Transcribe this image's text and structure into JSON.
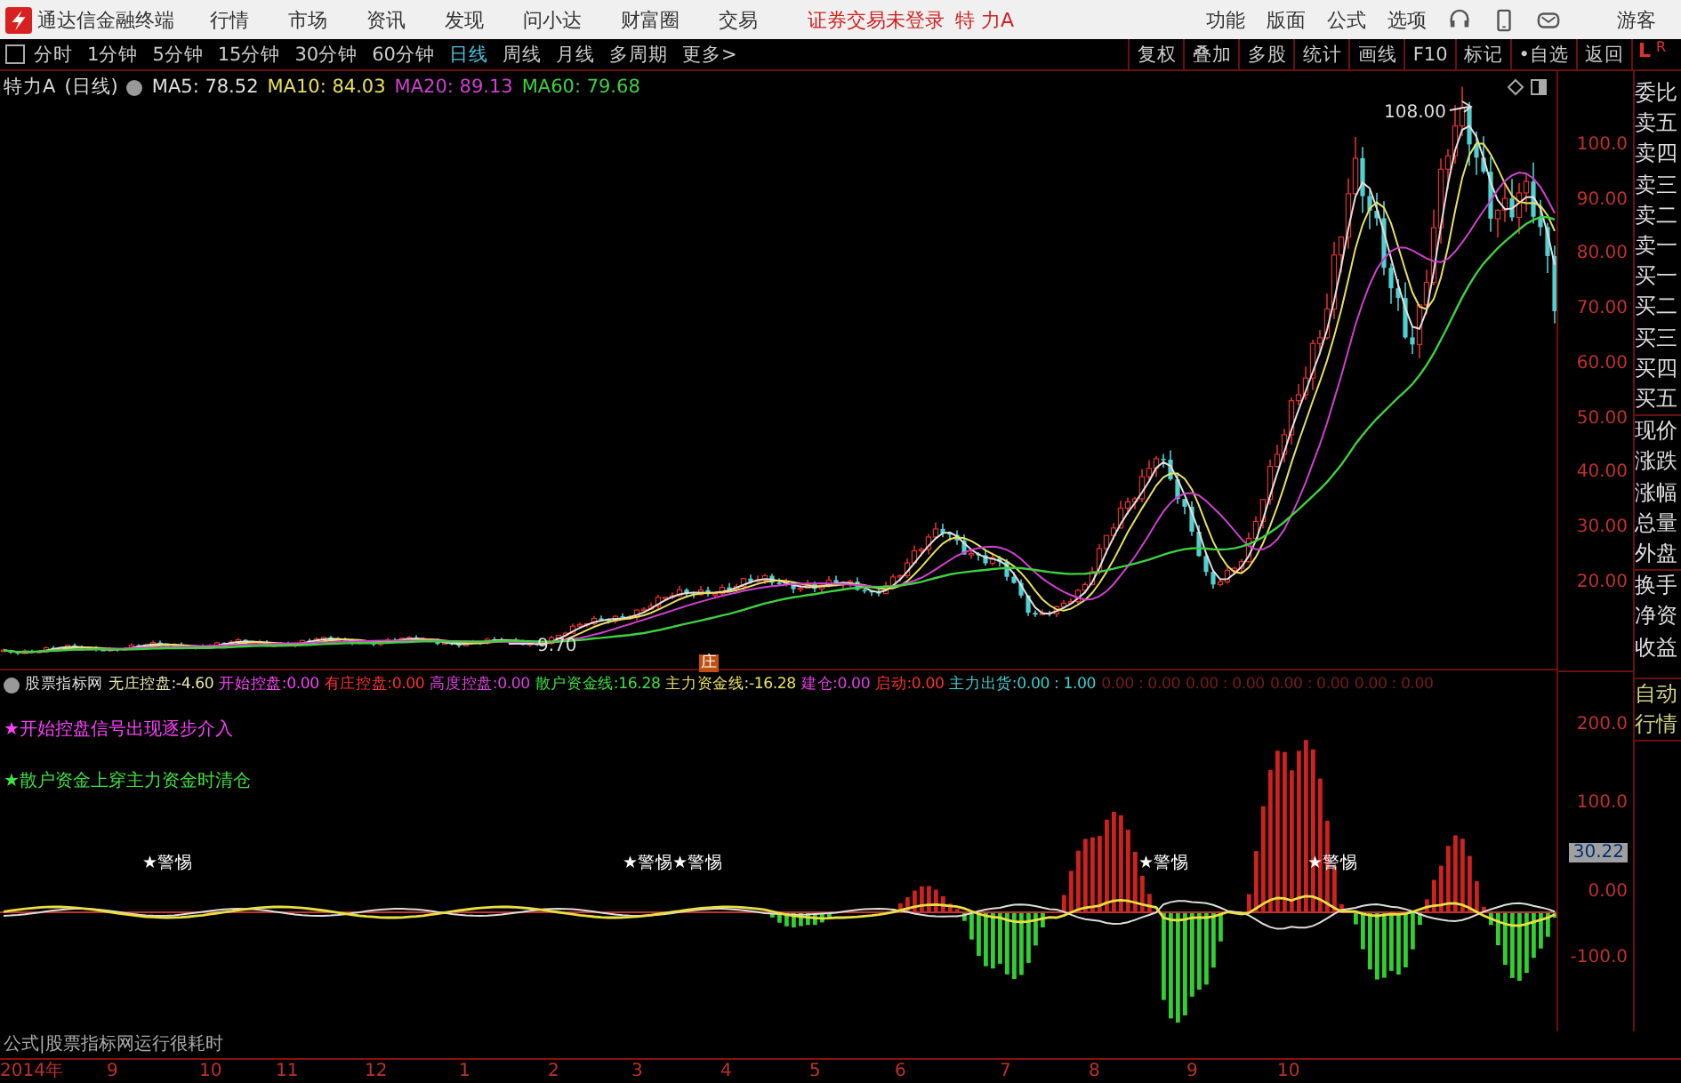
{
  "app": {
    "title": "通达信金融终端",
    "menus": [
      "行情",
      "市场",
      "资讯",
      "发现",
      "问小达",
      "财富圈",
      "交易"
    ],
    "login_status": "证券交易未登录",
    "stock_name": "特 力A",
    "tools": [
      "功能",
      "版面",
      "公式",
      "选项"
    ],
    "user": "游客"
  },
  "toolbar": {
    "periods": [
      {
        "label": "分时",
        "selected": false
      },
      {
        "label": "1分钟",
        "selected": false
      },
      {
        "label": "5分钟",
        "selected": false
      },
      {
        "label": "15分钟",
        "selected": false
      },
      {
        "label": "30分钟",
        "selected": false
      },
      {
        "label": "60分钟",
        "selected": false
      },
      {
        "label": "日线",
        "selected": true
      },
      {
        "label": "周线",
        "selected": false
      },
      {
        "label": "月线",
        "selected": false
      },
      {
        "label": "多周期",
        "selected": false
      },
      {
        "label": "更多>",
        "selected": false
      }
    ],
    "actions": [
      "复权",
      "叠加",
      "多股",
      "统计",
      "画线",
      "F10",
      "标记",
      "•自选",
      "返回"
    ],
    "corner_labels": [
      "L",
      "R"
    ]
  },
  "chart": {
    "stock": "特力A",
    "period": "(日线)",
    "ma": [
      {
        "label": "MA5:",
        "value": "78.52",
        "color": "#e0e0e0"
      },
      {
        "label": "MA10:",
        "value": "84.03",
        "color": "#e8e060"
      },
      {
        "label": "MA20:",
        "value": "89.13",
        "color": "#d040d0"
      },
      {
        "label": "MA60:",
        "value": "79.68",
        "color": "#40d040"
      }
    ],
    "high_label": "108.00",
    "low_label": "9.70",
    "marker": "庄",
    "price_axis": [
      "100.0",
      "90.00",
      "80.00",
      "70.00",
      "60.00",
      "50.00",
      "40.00",
      "30.00",
      "20.00"
    ]
  },
  "indicator": {
    "name": "股票指标网",
    "lines": [
      {
        "label": "无庄控盘:",
        "value": "-4.60",
        "color": "#e8e8b0"
      },
      {
        "label": "开始控盘:",
        "value": "0.00",
        "color": "#ff40ff"
      },
      {
        "label": "有庄控盘:",
        "value": "0.00",
        "color": "#ff3030"
      },
      {
        "label": "高度控盘:",
        "value": "0.00",
        "color": "#e040e0"
      },
      {
        "label": "散户资金线:",
        "value": "16.28",
        "color": "#40e040"
      },
      {
        "label": "主力资金线:",
        "value": "-16.28",
        "color": "#e8e060"
      },
      {
        "label": "建仓:",
        "value": "0.00",
        "color": "#e040e0"
      },
      {
        "label": "启动:",
        "value": "0.00",
        "color": "#ff3030"
      },
      {
        "label": "主力出货:",
        "value": "0.00 : 1.00",
        "color": "#40d0d0"
      },
      {
        "value": "0.00 : 0.00",
        "color": "#7a1c1c"
      },
      {
        "value": "0.00 : 0.00",
        "color": "#7a1c1c"
      },
      {
        "value": "0.00 : 0.00",
        "color": "#7a1c1c"
      },
      {
        "value": "0.00 : 0.00",
        "color": "#7a1c1c"
      }
    ],
    "signals": [
      {
        "text": "★开始控盘信号出现逐步介入",
        "color": "#ff40ff"
      },
      {
        "text": "★散户资金上穿主力资金时清仓",
        "color": "#40e040"
      }
    ],
    "annotations": [
      "★警惕",
      "★警惕",
      "★警惕",
      "★警惕",
      "★警惕"
    ],
    "axis": [
      {
        "label": "200.0",
        "kind": "tick"
      },
      {
        "label": "100.0",
        "kind": "tick"
      },
      {
        "label": "30.22",
        "kind": "current"
      },
      {
        "label": "0.00",
        "kind": "tick"
      },
      {
        "label": "-100.0",
        "kind": "tick"
      }
    ]
  },
  "side_panel": {
    "fields": [
      "委比",
      "卖五",
      "卖四",
      "卖三",
      "卖二",
      "卖一",
      "买一",
      "买二",
      "买三",
      "买四",
      "买五",
      "现价",
      "涨跌",
      "涨幅",
      "总量",
      "外盘",
      "换手",
      "净资",
      "收益"
    ],
    "auto_button": "自动行情"
  },
  "footer": {
    "note": "公式|股票指标网运行很耗时",
    "dates": [
      "2014年",
      "9",
      "10",
      "11",
      "12",
      "1",
      "2",
      "3",
      "4",
      "5",
      "6",
      "7",
      "8",
      "9",
      "10"
    ]
  }
}
